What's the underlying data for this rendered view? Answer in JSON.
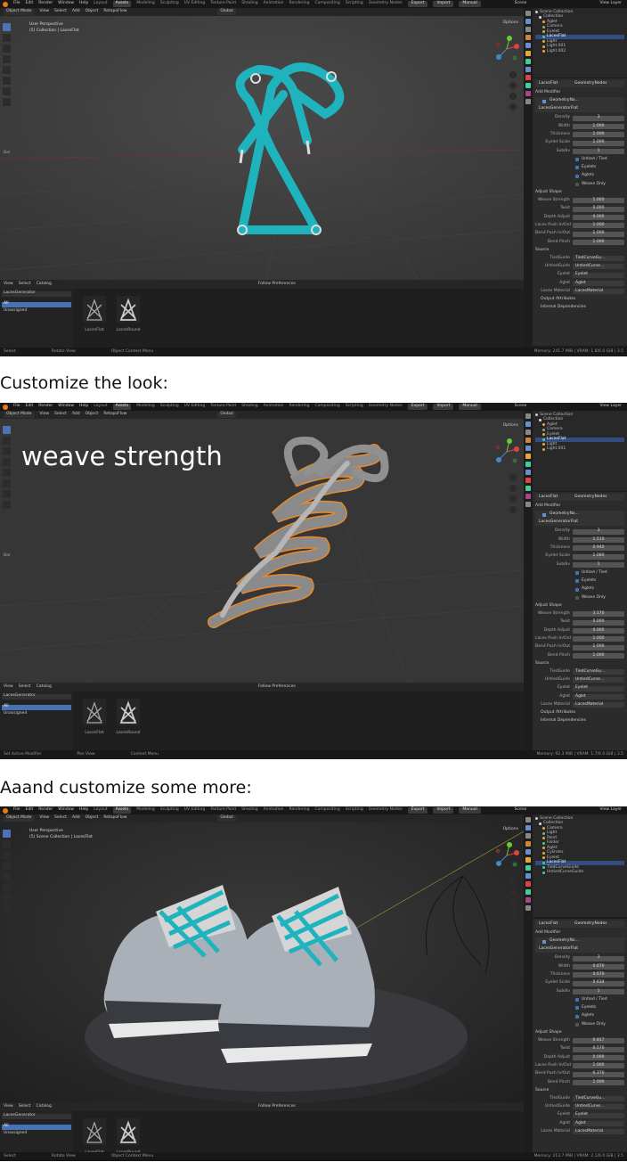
{
  "captions": [
    "Customize the look:",
    "Aaand customize some more:"
  ],
  "menu": {
    "items": [
      "File",
      "Edit",
      "Render",
      "Window",
      "Help"
    ],
    "workspaces": [
      "Layout",
      "Assets",
      "Modeling",
      "Sculpting",
      "UV Editing",
      "Texture Paint",
      "Shading",
      "Animation",
      "Rendering",
      "Compositing",
      "Scripting",
      "Geometry Nodes"
    ],
    "buttons": [
      "Export",
      "Import",
      "Manual"
    ],
    "scene": "Scene",
    "view_layer": "View Layer"
  },
  "shots": [
    {
      "header": {
        "mode": "Object Mode",
        "menus": [
          "View",
          "Select",
          "Add",
          "Object"
        ],
        "extra": "RetopoFlow",
        "orientation": "Global"
      },
      "viewport": {
        "line1": "User Perspective",
        "line2": "(5) Collection | LacesFlat",
        "options": "Options",
        "bar": "Bar",
        "overlay_text": ""
      },
      "assetbar": {
        "menus": [
          "View",
          "Select",
          "Catalog"
        ],
        "prefs": "Follow Preferences"
      },
      "asset_side": {
        "library": "LacesGenerator",
        "all": "All",
        "unassigned": "Unassigned"
      },
      "assets": [
        "LacesFlat",
        "LacesRound"
      ],
      "status": [
        "Select",
        "Rotate View",
        "Object Context Menu"
      ],
      "memory": "Memory: 241.7 MiB | VRAM: 1.8/6.0 GiB | 3.5",
      "outliner": {
        "rows": [
          "Scene Collection",
          "Collection",
          "Aglet",
          "Camera",
          "Eyelet",
          "LacesFlat",
          "Light",
          "Light.001",
          "Light.002"
        ]
      },
      "props": {
        "object": "LacesFlat",
        "node_group": "GeometryNodes",
        "add_modifier": "Add Modifier",
        "modifier": "GeometryNo...",
        "node_tree": "LacesGeneratorFlat",
        "values": [
          [
            "Density",
            "3"
          ],
          [
            "Width",
            "1.000"
          ],
          [
            "Thickness",
            "1.000"
          ],
          [
            "Eyelet Scale",
            "1.000"
          ],
          [
            "Subdiv",
            "1"
          ]
        ],
        "checks": [
          [
            "Untied / Tied",
            true
          ],
          [
            "Eyelets",
            true
          ],
          [
            "Aglets",
            true
          ],
          [
            "Weave Only",
            false
          ]
        ],
        "adjust_title": "Adjust Shape",
        "adjust": [
          [
            "Weave Strength",
            "1.000"
          ],
          [
            "Twist",
            "0.000"
          ],
          [
            "Depth Adjust",
            "0.000"
          ],
          [
            "Laces Push In/Out",
            "1.000"
          ],
          [
            "Bend Push In/Out",
            "1.000"
          ],
          [
            "Bend Pinch",
            "1.000"
          ]
        ],
        "source_title": "Source",
        "source": [
          [
            "TiedGuide",
            "TiedCurveGu..."
          ],
          [
            "UntiedGuide",
            "UntiedCurve..."
          ],
          [
            "Eyelet",
            "Eyelet"
          ],
          [
            "Aglet",
            "Aglet"
          ],
          [
            "Laces Material",
            "LacesMaterial"
          ]
        ],
        "subpanels": [
          "Output Attributes",
          "Internal Dependencies"
        ]
      }
    },
    {
      "header": {
        "mode": "Object Mode",
        "menus": [
          "View",
          "Select",
          "Add",
          "Object"
        ],
        "extra": "RetopoFlow",
        "orientation": "Global"
      },
      "viewport": {
        "line1": "",
        "line2": "",
        "options": "Options",
        "bar": "Bar",
        "overlay_text": "weave strength"
      },
      "assetbar": {
        "menus": [
          "View",
          "Select",
          "Catalog"
        ],
        "prefs": "Follow Preferences"
      },
      "asset_side": {
        "library": "LacesGenerator",
        "all": "All",
        "unassigned": "Unassigned"
      },
      "assets": [
        "LacesFlat",
        "LacesRound"
      ],
      "status": [
        "Set Active Modifier",
        "Pan View",
        "Context Menu"
      ],
      "memory": "Memory: 92.3 MiB | VRAM: 1.7/6.0 GiB | 3.5",
      "outliner": {
        "rows": [
          "Scene Collection",
          "Collection",
          "Aglet",
          "Camera",
          "Eyelet",
          "LacesFlat",
          "Light",
          "Light.001"
        ]
      },
      "props": {
        "object": "LacesFlat",
        "node_group": "GeometryNodes",
        "add_modifier": "Add Modifier",
        "modifier": "GeometryNo...",
        "node_tree": "LacesGeneratorFlat",
        "values": [
          [
            "Density",
            "3"
          ],
          [
            "Width",
            "1.510"
          ],
          [
            "Thickness",
            "0.940"
          ],
          [
            "Eyelet Scale",
            "1.080"
          ],
          [
            "Subdiv",
            "1"
          ]
        ],
        "checks": [
          [
            "Untied / Tied",
            true
          ],
          [
            "Eyelets",
            true
          ],
          [
            "Aglets",
            true
          ],
          [
            "Weave Only",
            false
          ]
        ],
        "adjust_title": "Adjust Shape",
        "adjust": [
          [
            "Weave Strength",
            "3.170"
          ],
          [
            "Twist",
            "0.000"
          ],
          [
            "Depth Adjust",
            "0.000"
          ],
          [
            "Laces Push In/Out",
            "1.000"
          ],
          [
            "Bend Push In/Out",
            "1.000"
          ],
          [
            "Bend Pinch",
            "1.000"
          ]
        ],
        "source_title": "Source",
        "source": [
          [
            "TiedGuide",
            "TiedCurveGu..."
          ],
          [
            "UntiedGuide",
            "UntiedCurve..."
          ],
          [
            "Eyelet",
            "Eyelet"
          ],
          [
            "Aglet",
            "Aglet"
          ],
          [
            "Laces Material",
            "LacesMaterial"
          ]
        ],
        "subpanels": [
          "Output Attributes",
          "Internal Dependencies"
        ]
      }
    },
    {
      "header": {
        "mode": "Object Mode",
        "menus": [
          "View",
          "Select",
          "Add",
          "Object"
        ],
        "extra": "RetopoFlow",
        "orientation": "Global"
      },
      "viewport": {
        "line1": "User Perspective",
        "line2": "(5) Scene Collection | LacesFlat",
        "options": "Options",
        "bar": "",
        "overlay_text": ""
      },
      "assetbar": {
        "menus": [
          "View",
          "Select",
          "Catalog"
        ],
        "prefs": "Follow Preferences"
      },
      "asset_side": {
        "library": "LacesGenerator",
        "all": "All",
        "unassigned": "Unassigned"
      },
      "assets": [
        "LacesFlat",
        "LacesRound"
      ],
      "status": [
        "Select",
        "Rotate View",
        "Object Context Menu"
      ],
      "memory": "Memory: 213.7 MiB | VRAM: 2.1/6.0 GiB | 3.5",
      "outliner": {
        "rows": [
          "Scene Collection",
          "Collection",
          "Camera",
          "Light",
          "Point",
          "Folder",
          "Aglet",
          "Cylinder",
          "Eyelet",
          "LacesFlat",
          "TiedCurveGuide",
          "UntiedCurveGuide"
        ]
      },
      "props": {
        "object": "LacesFlat",
        "node_group": "GeometryNodes",
        "add_modifier": "Add Modifier",
        "modifier": "GeometryNo...",
        "node_tree": "LacesGeneratorFlat",
        "values": [
          [
            "Density",
            "3"
          ],
          [
            "Width",
            "0.670"
          ],
          [
            "Thickness",
            "0.670"
          ],
          [
            "Eyelet Scale",
            "0.634"
          ],
          [
            "Subdiv",
            "1"
          ]
        ],
        "checks": [
          [
            "Untied / Tied",
            true
          ],
          [
            "Eyelets",
            true
          ],
          [
            "Aglets",
            true
          ],
          [
            "Weave Only",
            false
          ]
        ],
        "adjust_title": "Adjust Shape",
        "adjust": [
          [
            "Weave Strength",
            "0.817"
          ],
          [
            "Twist",
            "0.570"
          ],
          [
            "Depth Adjust",
            "0.000"
          ],
          [
            "Laces Push In/Out",
            "1.000"
          ],
          [
            "Bend Push In/Out",
            "0.370"
          ],
          [
            "Bend Pinch",
            "1.000"
          ]
        ],
        "source_title": "Source",
        "source": [
          [
            "TiedGuide",
            "TiedCurveGu..."
          ],
          [
            "UntiedGuide",
            "UntiedCurve..."
          ],
          [
            "Eyelet",
            "Eyelet"
          ],
          [
            "Aglet",
            "Aglet"
          ],
          [
            "Laces Material",
            "LacesMaterial"
          ]
        ],
        "subpanels": []
      }
    }
  ],
  "colors": {
    "lace_teal": "#1fb3bd",
    "accent_blue": "#4772b3",
    "orange_outline": "#e8892b"
  },
  "icons": [
    "blender-logo-icon",
    "select-box-icon",
    "cursor-icon",
    "move-icon",
    "rotate-icon",
    "scale-icon",
    "annotate-icon",
    "measure-icon",
    "navigation-gizmo-icon",
    "zoom-icon",
    "hand-icon",
    "camera-icon",
    "grid-icon",
    "eye-icon",
    "wrench-icon",
    "checkbox-icon"
  ]
}
